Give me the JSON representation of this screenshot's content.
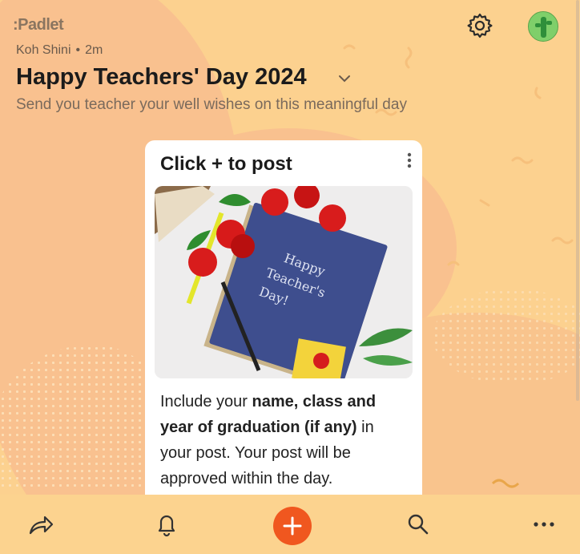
{
  "header": {
    "logo": ":Padlet",
    "author": "Koh Shini",
    "time": "2m",
    "title": "Happy Teachers' Day 2024",
    "description": "Send you teacher your well wishes on this meaningful day"
  },
  "card": {
    "title": "Click + to post",
    "photo_text": "Happy Teacher's Day!",
    "body_1": "Include your ",
    "body_bold": "name, class and year of graduation (if any)",
    "body_2": " in your post. Your post will be approved within the day."
  },
  "bottombar": {
    "icons": [
      "share-icon",
      "bell-icon",
      "add-post-button",
      "search-icon",
      "more-icon"
    ]
  },
  "colors": {
    "background": "#fcd18f",
    "accent": "#f0571f",
    "card": "#ffffff"
  }
}
